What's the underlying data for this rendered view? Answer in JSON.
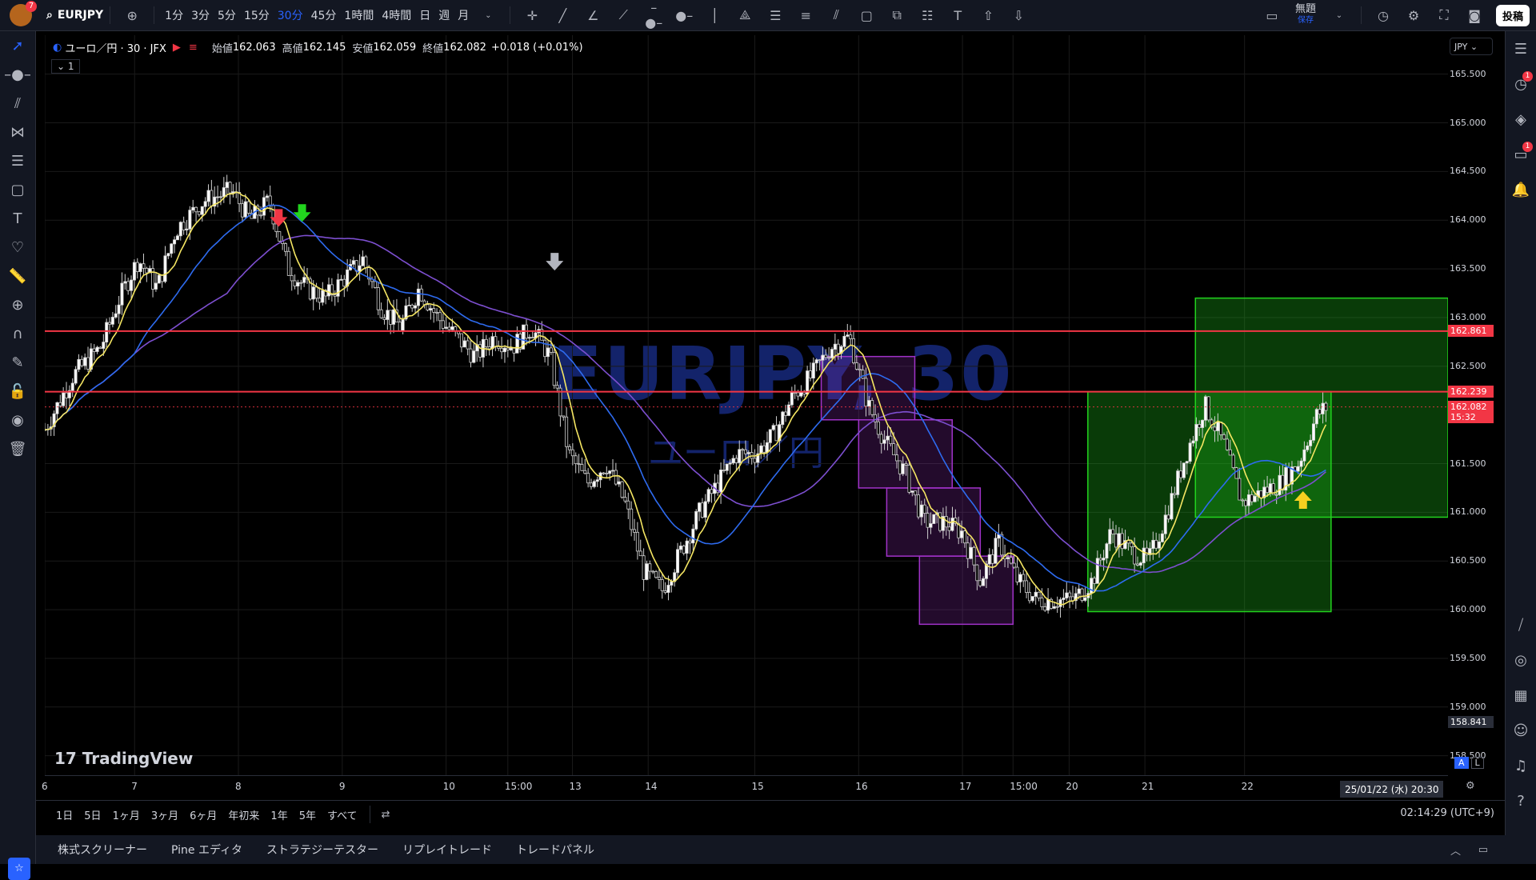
{
  "top": {
    "notifications": "7",
    "symbol": "EURJPY",
    "timeframes": [
      "1分",
      "3分",
      "5分",
      "15分",
      "30分",
      "45分",
      "1時間",
      "4時間",
      "日",
      "週",
      "月"
    ],
    "active_timeframe": "30分",
    "save_label": "無題",
    "save_sub": "保存",
    "post_label": "投稿"
  },
  "legend": {
    "title": "ユーロ／円 · 30 · JFX",
    "open_label": "始値",
    "open": "162.063",
    "high_label": "高値",
    "high": "162.145",
    "low_label": "安値",
    "low": "162.059",
    "close_label": "終値",
    "close": "162.082",
    "change": "+0.018 (+0.01%)",
    "indicator_count": "1"
  },
  "watermark": {
    "main": "EURJPY, 30",
    "sub": "ユーロ／円"
  },
  "axis": {
    "currency": "JPY",
    "ticks": [
      "165.500",
      "165.000",
      "164.500",
      "164.000",
      "163.500",
      "163.000",
      "162.500",
      "161.500",
      "161.000",
      "160.500",
      "160.000",
      "159.500",
      "159.000",
      "158.500"
    ],
    "tags": [
      {
        "text": "162.861",
        "color": "#f23645"
      },
      {
        "text": "162.239",
        "color": "#f23645"
      },
      {
        "text": "162.082",
        "sub": "15:32",
        "color": "#f23645"
      },
      {
        "text": "158.841",
        "color": "#2a2e39"
      }
    ],
    "scale_buttons": [
      "A",
      "L"
    ]
  },
  "xaxis": {
    "labels": [
      "6",
      "7",
      "8",
      "9",
      "10",
      "15:00",
      "13",
      "14",
      "15",
      "16",
      "17",
      "15:00",
      "20",
      "21",
      "22"
    ],
    "crosshair_label": "25/01/22 (水)   20:30"
  },
  "ranges": [
    "1日",
    "5日",
    "1ヶ月",
    "3ヶ月",
    "6ヶ月",
    "年初来",
    "1年",
    "5年",
    "すべて"
  ],
  "clock": "02:14:29 (UTC+9)",
  "panels": [
    "株式スクリーナー",
    "Pine エディタ",
    "ストラテジーテスター",
    "リプレイトレード",
    "トレードパネル"
  ],
  "branding": "TradingView",
  "right_badges": [
    "1",
    "1"
  ],
  "colors": {
    "bg": "#000000",
    "up": "#ffffff",
    "down": "#000000",
    "sma_fast": "#f5e663",
    "sma_mid": "#2e6bef",
    "sma_slow": "#7d4fd0",
    "hline": "#f23645",
    "box_green": "#22d41e",
    "box_purple": "#a032c8"
  },
  "chart_data": {
    "type": "candlestick",
    "symbol": "EURJPY",
    "interval": "30",
    "ylim": [
      158.3,
      165.9
    ],
    "horizontal_lines": [
      162.861,
      162.239
    ],
    "last_price": 162.082,
    "close_path": [
      [
        0,
        161.85
      ],
      [
        3,
        162.4
      ],
      [
        6,
        162.7
      ],
      [
        8,
        163.2
      ],
      [
        10,
        163.6
      ],
      [
        12,
        163.3
      ],
      [
        14,
        163.9
      ],
      [
        17,
        164.2
      ],
      [
        20,
        164.3
      ],
      [
        22,
        164.0
      ],
      [
        24,
        164.2
      ],
      [
        26,
        163.5
      ],
      [
        28,
        163.3
      ],
      [
        30,
        163.2
      ],
      [
        32,
        163.4
      ],
      [
        34,
        163.6
      ],
      [
        36,
        163.1
      ],
      [
        38,
        162.9
      ],
      [
        40,
        163.3
      ],
      [
        42,
        163.0
      ],
      [
        44,
        162.8
      ],
      [
        46,
        162.6
      ],
      [
        48,
        162.8
      ],
      [
        50,
        162.7
      ],
      [
        52,
        162.9
      ],
      [
        54,
        162.6
      ],
      [
        56,
        161.6
      ],
      [
        58,
        161.3
      ],
      [
        60,
        161.5
      ],
      [
        62,
        161.1
      ],
      [
        64,
        160.4
      ],
      [
        66,
        160.2
      ],
      [
        68,
        160.6
      ],
      [
        70,
        161.0
      ],
      [
        72,
        161.3
      ],
      [
        74,
        161.6
      ],
      [
        76,
        161.6
      ],
      [
        78,
        161.8
      ],
      [
        80,
        162.2
      ],
      [
        82,
        162.4
      ],
      [
        84,
        162.7
      ],
      [
        86,
        162.8
      ],
      [
        88,
        162.1
      ],
      [
        90,
        161.7
      ],
      [
        92,
        161.4
      ],
      [
        94,
        160.9
      ],
      [
        96,
        160.9
      ],
      [
        98,
        160.8
      ],
      [
        100,
        160.3
      ],
      [
        102,
        160.7
      ],
      [
        104,
        160.3
      ],
      [
        106,
        160.1
      ],
      [
        108,
        160.1
      ],
      [
        110,
        160.1
      ],
      [
        112,
        160.3
      ],
      [
        114,
        160.8
      ],
      [
        116,
        160.6
      ],
      [
        118,
        160.5
      ],
      [
        120,
        161.0
      ],
      [
        122,
        161.6
      ],
      [
        124,
        162.1
      ],
      [
        126,
        161.7
      ],
      [
        128,
        161.1
      ],
      [
        130,
        161.2
      ],
      [
        132,
        161.3
      ],
      [
        134,
        161.5
      ],
      [
        136,
        162.0
      ],
      [
        137,
        162.08
      ]
    ],
    "markers": [
      {
        "type": "arrow-down",
        "color": "#f23645",
        "at": 25,
        "price": 163.95
      },
      {
        "type": "arrow-down",
        "color": "#22d41e",
        "at": 27.5,
        "price": 164.0
      },
      {
        "type": "arrow-down",
        "color": "#b2b5be",
        "at": 54.5,
        "price": 163.5
      },
      {
        "type": "arrow-up",
        "color": "#f5d020",
        "at": 134.5,
        "price": 161.2
      }
    ],
    "boxes": [
      {
        "color": "green",
        "from": 111.5,
        "to": 137.5,
        "top": 162.239,
        "bottom": 159.98
      },
      {
        "color": "green",
        "from": 123,
        "to": 150,
        "top": 163.2,
        "bottom": 160.95
      },
      {
        "color": "purple",
        "from": 83,
        "to": 93,
        "top": 162.6,
        "bottom": 161.95
      },
      {
        "color": "purple",
        "from": 87,
        "to": 97,
        "top": 161.95,
        "bottom": 161.25
      },
      {
        "color": "purple",
        "from": 90,
        "to": 100,
        "top": 161.25,
        "bottom": 160.55
      },
      {
        "color": "purple",
        "from": 93.5,
        "to": 103.5,
        "top": 160.55,
        "bottom": 159.85
      }
    ],
    "extent": 150
  }
}
